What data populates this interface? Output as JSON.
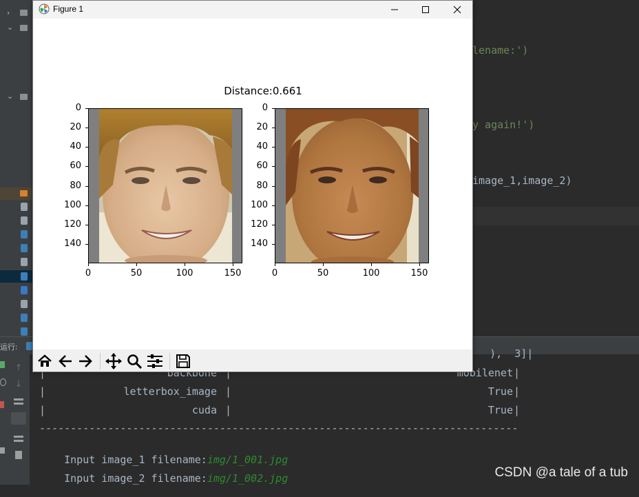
{
  "window": {
    "title": "Figure 1",
    "buttons": {
      "minimize": "minimize-icon",
      "maximize": "maximize-icon",
      "close": "close-icon"
    }
  },
  "figure": {
    "title": "Distance:0.661"
  },
  "chart_data": [
    {
      "type": "image",
      "title": "",
      "ylim": [
        160,
        0
      ],
      "xlim": [
        0,
        160
      ],
      "y_ticks": [
        "0",
        "20",
        "40",
        "60",
        "80",
        "100",
        "120",
        "140"
      ],
      "x_ticks": [
        "0",
        "50",
        "100",
        "150"
      ],
      "content": "face photo, gray padding left/right"
    },
    {
      "type": "image",
      "title": "",
      "ylim": [
        160,
        0
      ],
      "xlim": [
        0,
        160
      ],
      "y_ticks": [
        "0",
        "20",
        "40",
        "60",
        "80",
        "100",
        "120",
        "140"
      ],
      "x_ticks": [
        "0",
        "50",
        "100",
        "150"
      ],
      "content": "face photo, gray padding left/right"
    }
  ],
  "toolbar": {
    "buttons": [
      {
        "icon": "home-icon"
      },
      {
        "icon": "back-arrow-icon"
      },
      {
        "icon": "forward-arrow-icon"
      },
      {
        "icon": "pan-icon"
      },
      {
        "icon": "zoom-icon"
      },
      {
        "icon": "configure-subplots-icon"
      },
      {
        "icon": "save-icon"
      }
    ]
  },
  "editor": {
    "line1": "lename:')",
    "line2": "y again!')",
    "line3_a": "image_1",
    "line3_b": ",image_2)"
  },
  "run_panel": {
    "tab_label": "运行:"
  },
  "console": {
    "top_fragment": "   ),  3]|",
    "rows": [
      {
        "key": "backbone",
        "value": "mobilenet"
      },
      {
        "key": "letterbox_image",
        "value": "True"
      },
      {
        "key": "cuda",
        "value": "True"
      }
    ],
    "separator": "-----------------------------------------------------------------------------",
    "inputs": [
      {
        "prompt": "Input image_1 filename:",
        "value": "img/1_001.jpg"
      },
      {
        "prompt": "Input image_2 filename:",
        "value": "img/1_002.jpg"
      }
    ]
  },
  "watermark": "CSDN @a tale of a tub"
}
